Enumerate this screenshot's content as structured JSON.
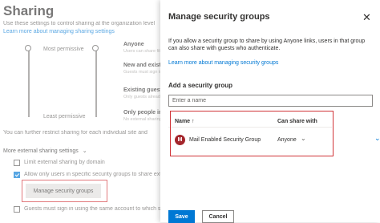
{
  "background": {
    "title": "Sharing",
    "description": "Use these settings to control sharing at the organization level",
    "learn_more": "Learn more about managing sharing settings",
    "most_permissive": "Most permissive",
    "least_permissive": "Least permissive",
    "levels": [
      {
        "label": "Anyone",
        "sub": "Users can share files and folders"
      },
      {
        "label": "New and exist",
        "sub": "Guests must sign in"
      },
      {
        "label": "Existing guest",
        "sub": "Only guests already in your directory"
      },
      {
        "label": "Only people in",
        "sub": "No external sharing allowed"
      }
    ],
    "further_restrict": "You can further restrict sharing for each individual site and",
    "more_settings": "More external sharing settings",
    "limit_domain": "Limit external sharing by domain",
    "allow_only_groups": "Allow only users in specific security groups to share exter",
    "manage_button": "Manage security groups",
    "guests_sign_in": "Guests must sign in using the same account to which share"
  },
  "panel": {
    "title": "Manage security groups",
    "close": "✕",
    "description": "If you allow a security group to share by using Anyone links, users in that group can also share with guests who authenticate.",
    "learn_more": "Learn more about managing security groups",
    "add_label": "Add a security group",
    "input_placeholder": "Enter a name",
    "col_name": "Name ↑",
    "col_share": "Can share with",
    "row": {
      "initial": "M",
      "name": "Mail Enabled Security Group",
      "permission": "Anyone"
    },
    "save": "Save",
    "cancel": "Cancel"
  },
  "colors": {
    "accent": "#0078d4",
    "highlight": "#d13438",
    "avatar": "#a4262c"
  }
}
